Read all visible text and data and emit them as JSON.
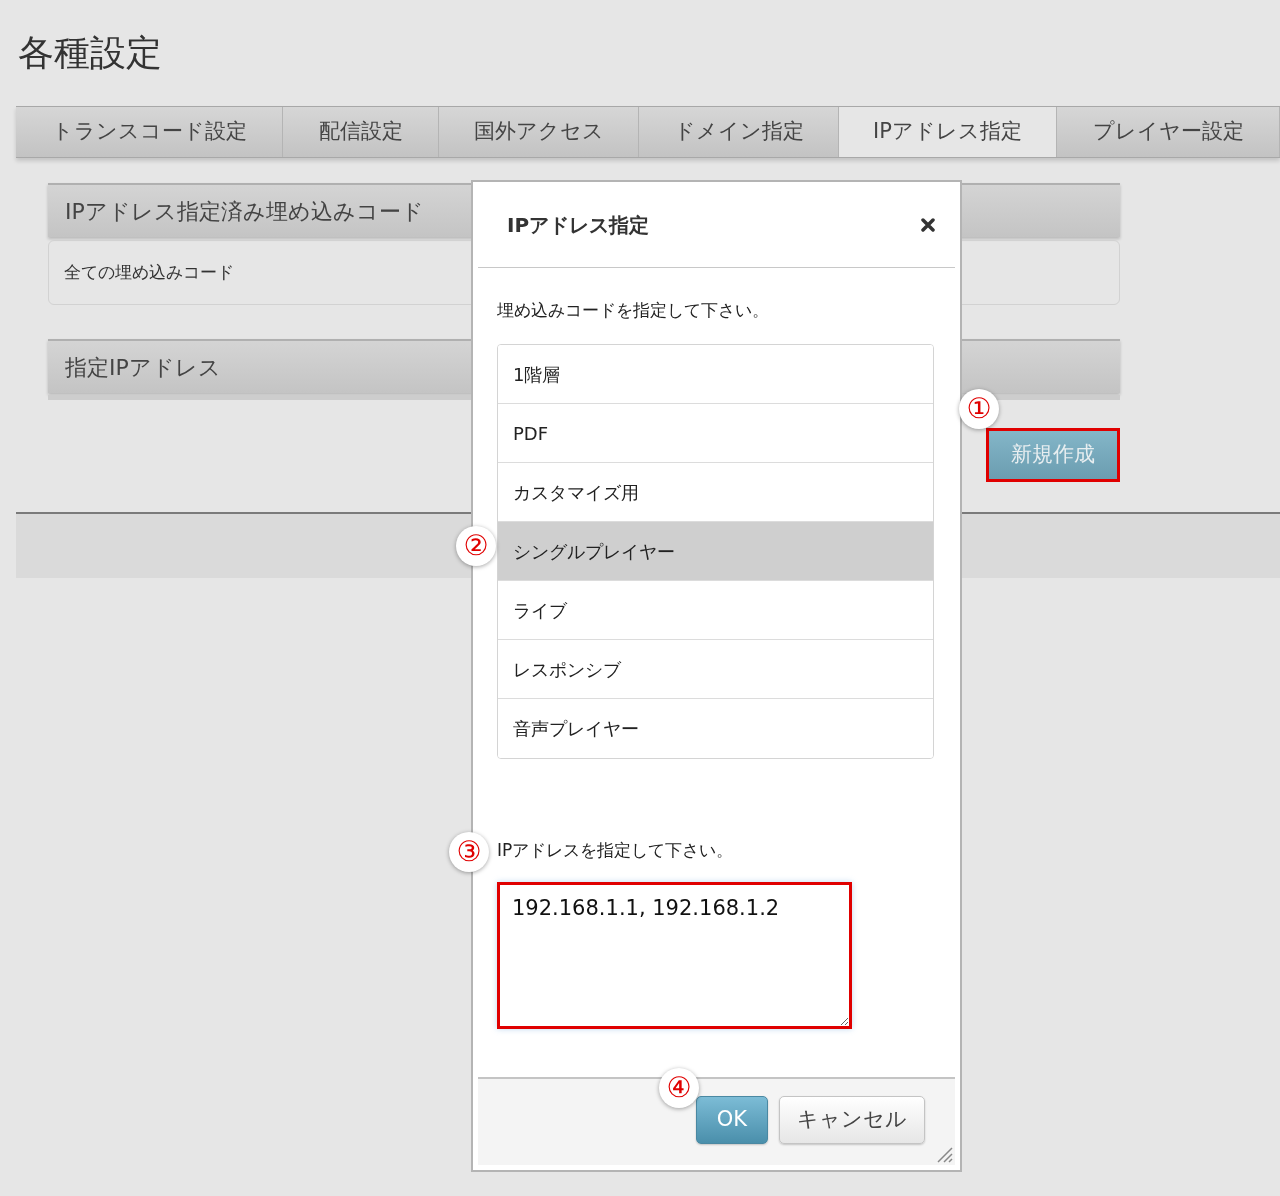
{
  "page_title": "各種設定",
  "tabs": [
    {
      "label": "トランスコード設定",
      "selected": false
    },
    {
      "label": "配信設定",
      "selected": false
    },
    {
      "label": "国外アクセス",
      "selected": false
    },
    {
      "label": "ドメイン指定",
      "selected": false
    },
    {
      "label": "IPアドレス指定",
      "selected": true
    },
    {
      "label": "プレイヤー設定",
      "selected": false
    }
  ],
  "sections": [
    {
      "title": "IPアドレス指定済み埋め込みコード",
      "body": "全ての埋め込みコード"
    },
    {
      "title": "指定IPアドレス"
    }
  ],
  "new_button": {
    "label": "新規作成",
    "highlighted": true
  },
  "dialog": {
    "title": "IPアドレス指定",
    "embed_prompt": "埋め込みコードを指定して下さい。",
    "embed_options": [
      {
        "label": "1階層",
        "selected": false
      },
      {
        "label": "PDF",
        "selected": false
      },
      {
        "label": "カスタマイズ用",
        "selected": false
      },
      {
        "label": "シングルプレイヤー",
        "selected": true
      },
      {
        "label": "ライブ",
        "selected": false
      },
      {
        "label": "レスポンシブ",
        "selected": false
      },
      {
        "label": "音声プレイヤー",
        "selected": false
      }
    ],
    "ip_prompt": "IPアドレスを指定して下さい。",
    "ip_field": {
      "value": "192.168.1.1, 192.168.1.2",
      "highlighted": true
    },
    "buttons": [
      {
        "label": "OK",
        "kind": "primary"
      },
      {
        "label": "キャンセル",
        "kind": "secondary"
      }
    ]
  },
  "callouts": [
    {
      "label": "①",
      "kind": "new-button"
    },
    {
      "label": "②",
      "kind": "embed-option"
    },
    {
      "label": "③",
      "kind": "ip-field"
    },
    {
      "label": "④",
      "kind": "ok-button"
    }
  ]
}
